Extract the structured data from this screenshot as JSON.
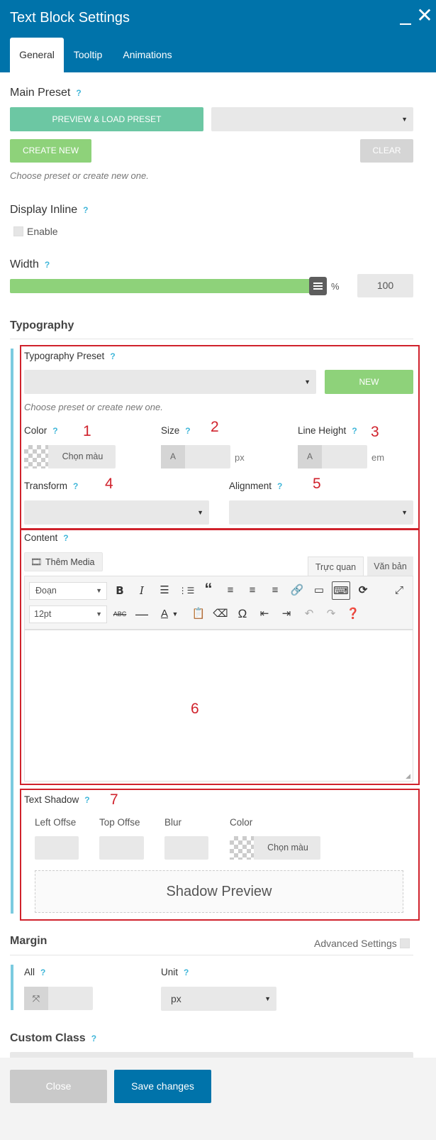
{
  "window": {
    "title": "Text Block Settings"
  },
  "tabs": [
    {
      "label": "General"
    },
    {
      "label": "Tooltip"
    },
    {
      "label": "Animations"
    }
  ],
  "help": "?",
  "main_preset": {
    "label": "Main Preset",
    "preview_button": "PREVIEW & LOAD PRESET",
    "create_button": "CREATE NEW",
    "clear_button": "CLEAR",
    "hint": "Choose preset or create new one."
  },
  "display_inline": {
    "label": "Display Inline",
    "checkbox_label": "Enable",
    "checked": false
  },
  "width": {
    "label": "Width",
    "unit": "%",
    "value": "100",
    "slider_percent": 100
  },
  "typography": {
    "heading": "Typography",
    "preset_label": "Typography Preset",
    "new_button": "NEW",
    "hint": "Choose preset or create new one.",
    "color_label": "Color",
    "color_button": "Chọn màu",
    "size_label": "Size",
    "size_prefix": "A",
    "size_unit": "px",
    "line_height_label": "Line Height",
    "line_height_prefix": "A",
    "line_height_unit": "em",
    "transform_label": "Transform",
    "alignment_label": "Alignment"
  },
  "content": {
    "label": "Content",
    "add_media": "Thêm Media",
    "tab_visual": "Trực quan",
    "tab_text": "Văn bản",
    "format_select": "Đoạn",
    "size_select": "12pt"
  },
  "text_shadow": {
    "label": "Text Shadow",
    "left_offset": "Left Offse",
    "top_offset": "Top Offse",
    "blur": "Blur",
    "color": "Color",
    "color_button": "Chọn màu",
    "preview": "Shadow Preview"
  },
  "margin": {
    "heading": "Margin",
    "advanced": "Advanced Settings",
    "all_label": "All",
    "unit_label": "Unit",
    "unit_value": "px"
  },
  "custom_class": {
    "label": "Custom Class"
  },
  "annotations": [
    "1",
    "2",
    "3",
    "4",
    "5",
    "6",
    "7"
  ],
  "footer": {
    "close": "Close",
    "save": "Save changes"
  },
  "colors": {
    "header": "#0073aa",
    "accent_green": "#8ed27a",
    "accent_teal": "#6cc7a3",
    "annotation_red": "#d0222c",
    "save_button": "#0073aa"
  }
}
